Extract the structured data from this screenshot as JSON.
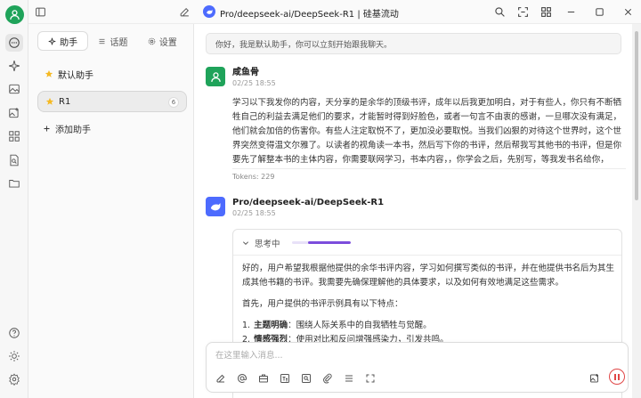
{
  "window": {
    "title": "Pro/deepseek-ai/DeepSeek-R1 | 硅基流动"
  },
  "colors": {
    "accent": "#1fa35a",
    "model_badge": "#4d6bfe",
    "thinking": "#7c4ddc",
    "stop": "#e04646"
  },
  "rail": {
    "icons": [
      "chat-icon",
      "sparkle-icon",
      "image-icon",
      "image-add-icon",
      "apps-icon",
      "doc-search-icon",
      "folder-icon",
      "help-icon",
      "sun-icon",
      "gear-icon"
    ]
  },
  "panel": {
    "tabs": [
      {
        "label": "助手",
        "icon": "sparkle-icon"
      },
      {
        "label": "话题",
        "icon": "list-icon"
      },
      {
        "label": "设置",
        "icon": "gear-icon"
      }
    ],
    "assistants": [
      {
        "label": "默认助手",
        "icon": "star-icon"
      },
      {
        "label": "R1",
        "icon": "star-icon",
        "count": "6"
      }
    ],
    "add_label": "添加助手"
  },
  "chat": {
    "welcome": "你好，我是默认助手，你可以立刻开始跟我聊天。",
    "user_message": {
      "name": "咸鱼骨",
      "time": "02/25 18:55",
      "text": "学习以下我发你的内容，天分享的是余华的顶级书评，成年以后我更加明白，对于有些人，你只有不断牺牲自己的利益去满足他们的要求，才能暂时得到好脸色，或者一句言不由衷的感谢，一旦哪次没有满足，他们就会加倍的伤害你。有些人注定取悦不了，更加没必要取悦。当我们凶狠的对待这个世界时，这个世界突然变得温文尔雅了。以读者的视角读一本书，然后写下你的书评，然后帮我写其他书的书评，但是你要先了解整本书的主体内容，你需要联网学习，书本内容，，你学会之后，先别写，等我发书名给你，",
      "tokens": "Tokens: 229"
    },
    "bot_message": {
      "name": "Pro/deepseek-ai/DeepSeek-R1",
      "time": "02/25 18:55",
      "thinking_label": "思考中",
      "thinking_progress": 0.73,
      "paragraphs": [
        "好的，用户希望我根据他提供的余华书评内容，学习如何撰写类似的书评，并在他提供书名后为其生成其他书籍的书评。我需要先确保理解他的具体要求，以及如何有效地满足这些需求。",
        "首先，用户提供的书评示例具有以下特点："
      ],
      "list": [
        {
          "num": "1.",
          "bold": "主题明确",
          "rest": "：围绕人际关系中的自我牺牲与觉醒。"
        },
        {
          "num": "2.",
          "bold": "情感强烈",
          "rest": "：使用对比和反问增强感染力，引发共鸣。"
        }
      ]
    }
  },
  "composer": {
    "placeholder": "在这里输入消息...",
    "tools": [
      "edit-icon",
      "at-icon",
      "briefcase-icon",
      "translate-icon",
      "web-search-icon",
      "attach-icon",
      "list-icon",
      "expand-icon"
    ],
    "right_tools": [
      "image-add-icon",
      "stop-icon"
    ]
  }
}
